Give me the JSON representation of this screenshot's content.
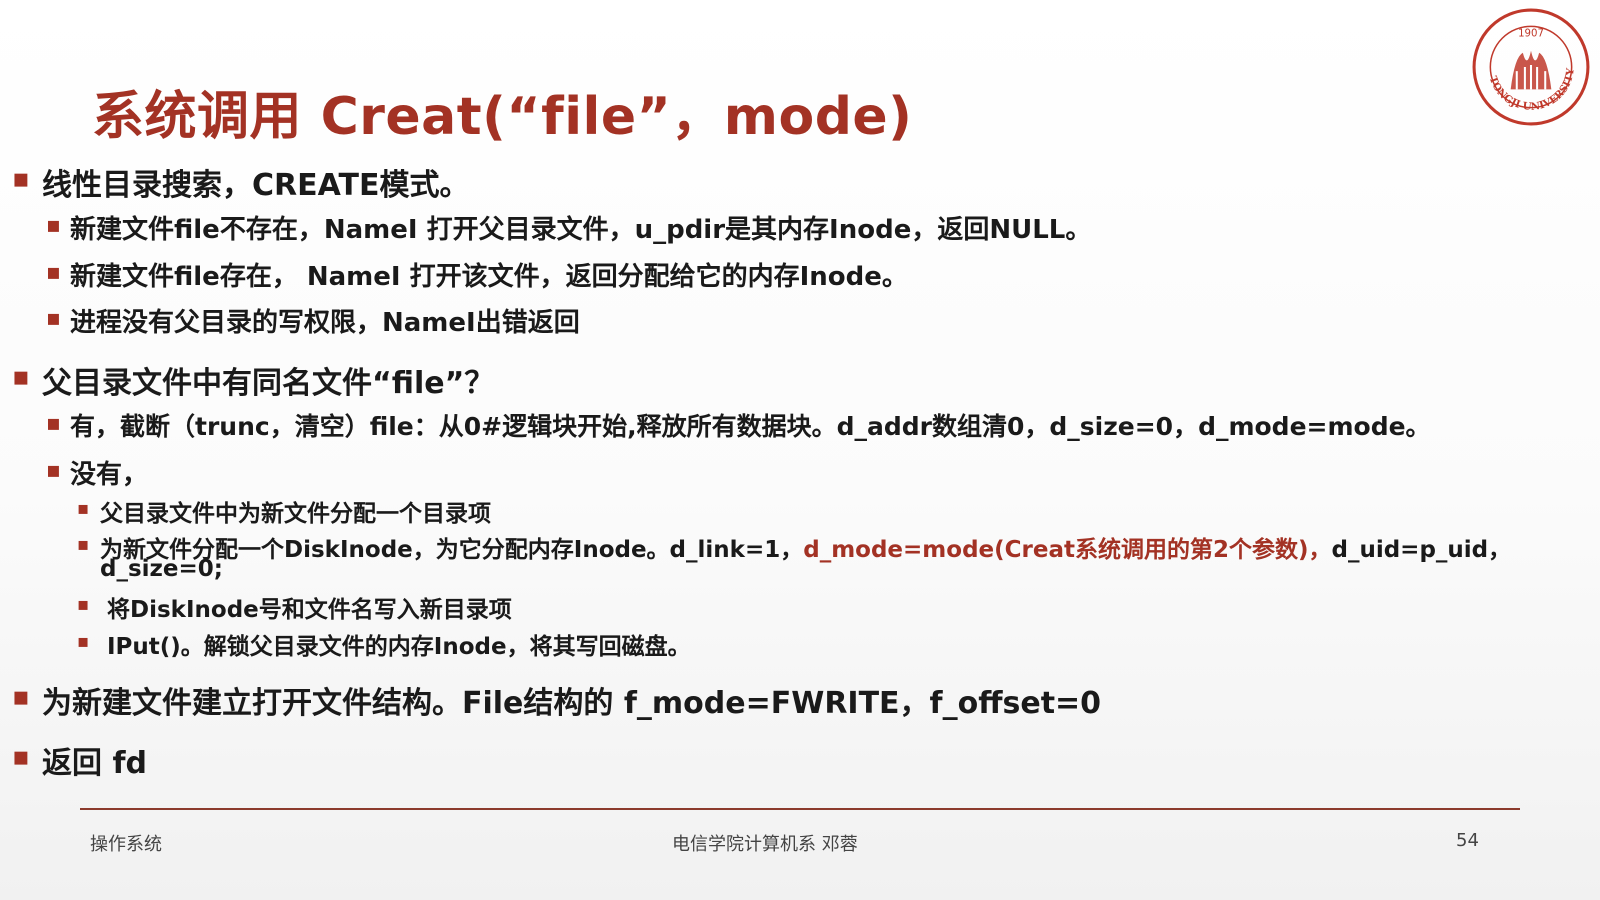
{
  "title": "系统调用 Creat(“file”，mode)",
  "logo": {
    "year": "1907",
    "ring_text": "TONGJI UNIVERSITY",
    "icon": "tongji-university-seal"
  },
  "bullets": [
    "线性目录搜索，CREATE模式。",
    "新建文件file不存在，NameI 打开父目录文件，u_pdir是其内存Inode，返回NULL。",
    "新建文件file存在， NameI 打开该文件，返回分配给它的内存Inode。",
    "进程没有父目录的写权限，NameI出错返回",
    "父目录文件中有同名文件“file”？",
    "有，截断（trunc，清空）file：从0#逻辑块开始,释放所有数据块。d_addr数组清0，d_size=0，d_mode=mode。",
    "没有，",
    "父目录文件中为新文件分配一个目录项",
    "将DiskInode号和文件名写入新目录项",
    "IPut()。解锁父目录文件的内存Inode，将其写回磁盘。",
    "为新建文件建立打开文件结构。File结构的 f_mode=FWRITE，f_offset=0",
    "返回 fd"
  ],
  "alloc_item": {
    "part1": "为新文件分配一个DiskInode，为它分配内存Inode。d_link=1，",
    "part2_red": "d_mode=mode(Creat系统调用的第2个参数)，",
    "part3": "d_uid=p_uid，",
    "part4": "d_size=0;"
  },
  "footer": {
    "left": "操作系统",
    "center": "电信学院计算机系 邓蓉",
    "page": "54"
  },
  "colors": {
    "accent": "#a33224",
    "text": "#1a1a1a"
  },
  "bullet_glyph": "▪"
}
